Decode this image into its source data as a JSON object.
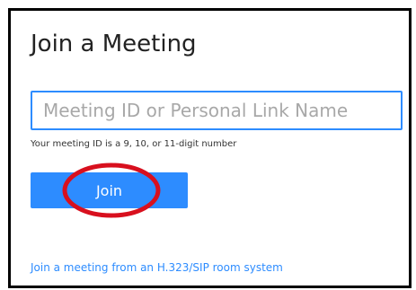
{
  "dialog": {
    "title": "Join a Meeting",
    "meeting_id_input": {
      "placeholder": "Meeting ID or Personal Link Name",
      "value": ""
    },
    "hint": "Your meeting ID is a 9, 10, or 11-digit number",
    "join_label": "Join",
    "h323_link": "Join a meeting from an H.323/SIP room system"
  },
  "colors": {
    "accent": "#2d8cff",
    "highlight_circle": "#d8101e",
    "frame_border": "#000000"
  }
}
